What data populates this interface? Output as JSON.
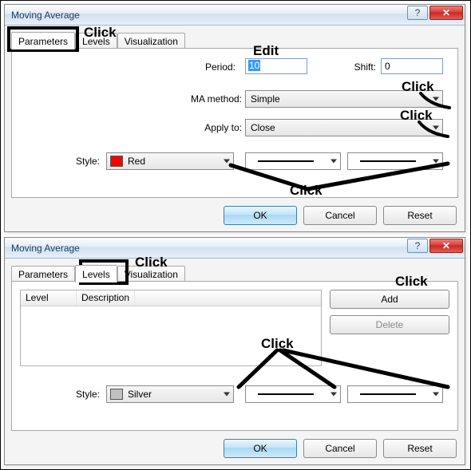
{
  "dlg1": {
    "title": "Moving Average",
    "helpGlyph": "?",
    "closeGlyph": "✕",
    "tabs": {
      "parameters": "Parameters",
      "levels": "Levels",
      "visualization": "Visualization"
    },
    "labels": {
      "period": "Period:",
      "shift": "Shift:",
      "method": "MA method:",
      "apply": "Apply to:",
      "style": "Style:"
    },
    "values": {
      "period": "10",
      "shift": "0",
      "method": "Simple",
      "apply": "Close",
      "style_color": "Red"
    },
    "buttons": {
      "ok": "OK",
      "cancel": "Cancel",
      "reset": "Reset"
    }
  },
  "dlg2": {
    "title": "Moving Average",
    "helpGlyph": "?",
    "closeGlyph": "✕",
    "tabs": {
      "parameters": "Parameters",
      "levels": "Levels",
      "visualization": "Visualization"
    },
    "grid": {
      "colLevel": "Level",
      "colDesc": "Description"
    },
    "labels": {
      "style": "Style:"
    },
    "values": {
      "style_color": "Silver"
    },
    "sideButtons": {
      "add": "Add",
      "delete": "Delete"
    },
    "buttons": {
      "ok": "OK",
      "cancel": "Cancel",
      "reset": "Reset"
    }
  },
  "annotations": {
    "click": "Click",
    "edit": "Edit"
  }
}
